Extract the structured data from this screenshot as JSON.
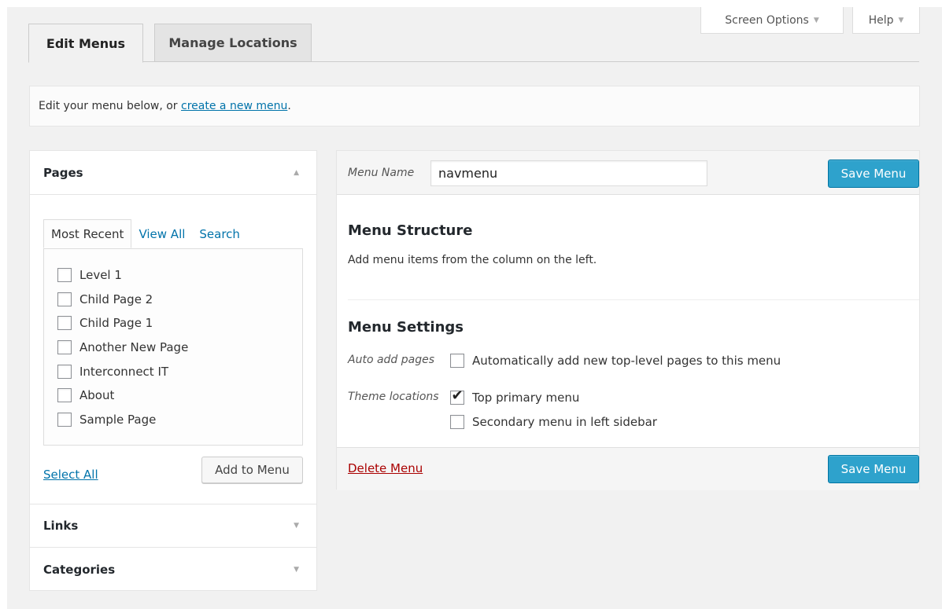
{
  "screen_meta": {
    "screen_options": "Screen Options",
    "help": "Help"
  },
  "tabs": [
    {
      "label": "Edit Menus",
      "active": true
    },
    {
      "label": "Manage Locations",
      "active": false
    }
  ],
  "notice": {
    "prefix": "Edit your menu below, or ",
    "link": "create a new menu",
    "suffix": "."
  },
  "sidebar": {
    "pages": {
      "title": "Pages",
      "subtabs": [
        "Most Recent",
        "View All",
        "Search"
      ],
      "items": [
        {
          "label": "Level 1",
          "checked": false
        },
        {
          "label": "Child Page 2",
          "checked": false
        },
        {
          "label": "Child Page 1",
          "checked": false
        },
        {
          "label": "Another New Page",
          "checked": false
        },
        {
          "label": "Interconnect IT",
          "checked": false
        },
        {
          "label": "About",
          "checked": false
        },
        {
          "label": "Sample Page",
          "checked": false
        }
      ],
      "select_all": "Select All",
      "add_button": "Add to Menu"
    },
    "links": {
      "title": "Links"
    },
    "categories": {
      "title": "Categories"
    }
  },
  "menu": {
    "name_label": "Menu Name",
    "name_value": "navmenu",
    "save_label": "Save Menu",
    "structure_title": "Menu Structure",
    "structure_desc": "Add menu items from the column on the left.",
    "settings_title": "Menu Settings",
    "auto_add_label": "Auto add pages",
    "auto_add_option": "Automatically add new top-level pages to this menu",
    "auto_add_checked": false,
    "theme_locations_label": "Theme locations",
    "locations": [
      {
        "label": "Top primary menu",
        "checked": true
      },
      {
        "label": "Secondary menu in left sidebar",
        "checked": false
      }
    ],
    "delete_label": "Delete Menu"
  },
  "colors": {
    "primary": "#2ea2cc",
    "link": "#0073aa",
    "delete": "#a00000"
  }
}
